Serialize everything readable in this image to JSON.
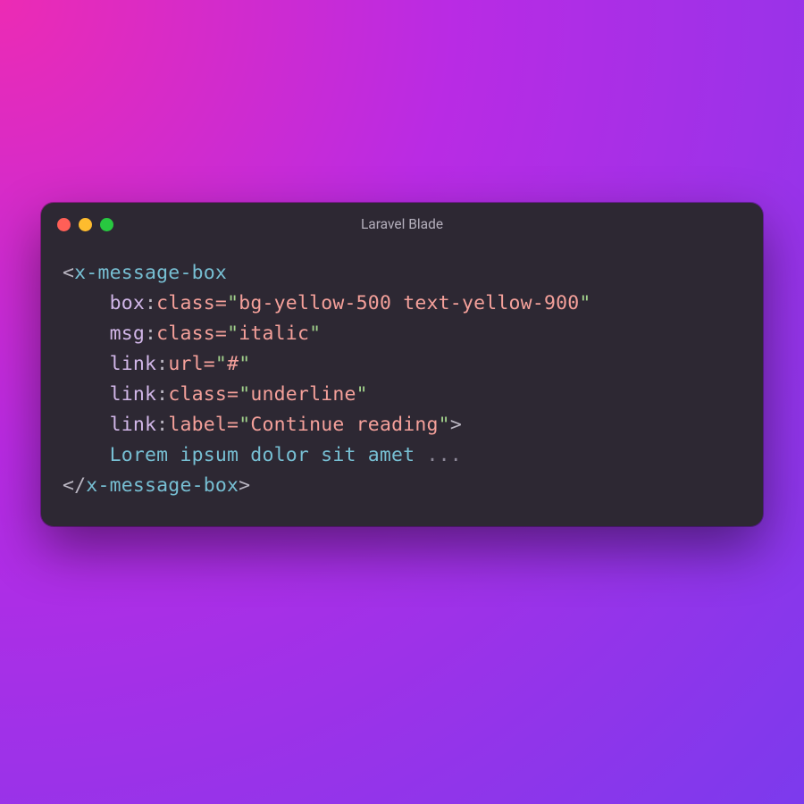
{
  "title": "Laravel Blade",
  "code": {
    "tag_open": "x-message-box",
    "tag_close": "x-message-box",
    "content_text": "Lorem ipsum dolor sit amet",
    "content_ellipsis": "...",
    "attrs": [
      {
        "prefix": "box",
        "name": "class",
        "value": "bg-yellow-500 text-yellow-900"
      },
      {
        "prefix": "msg",
        "name": "class",
        "value": "italic"
      },
      {
        "prefix": "link",
        "name": "url",
        "value": "#"
      },
      {
        "prefix": "link",
        "name": "class",
        "value": "underline"
      },
      {
        "prefix": "link",
        "name": "label",
        "value": "Continue reading"
      }
    ]
  }
}
